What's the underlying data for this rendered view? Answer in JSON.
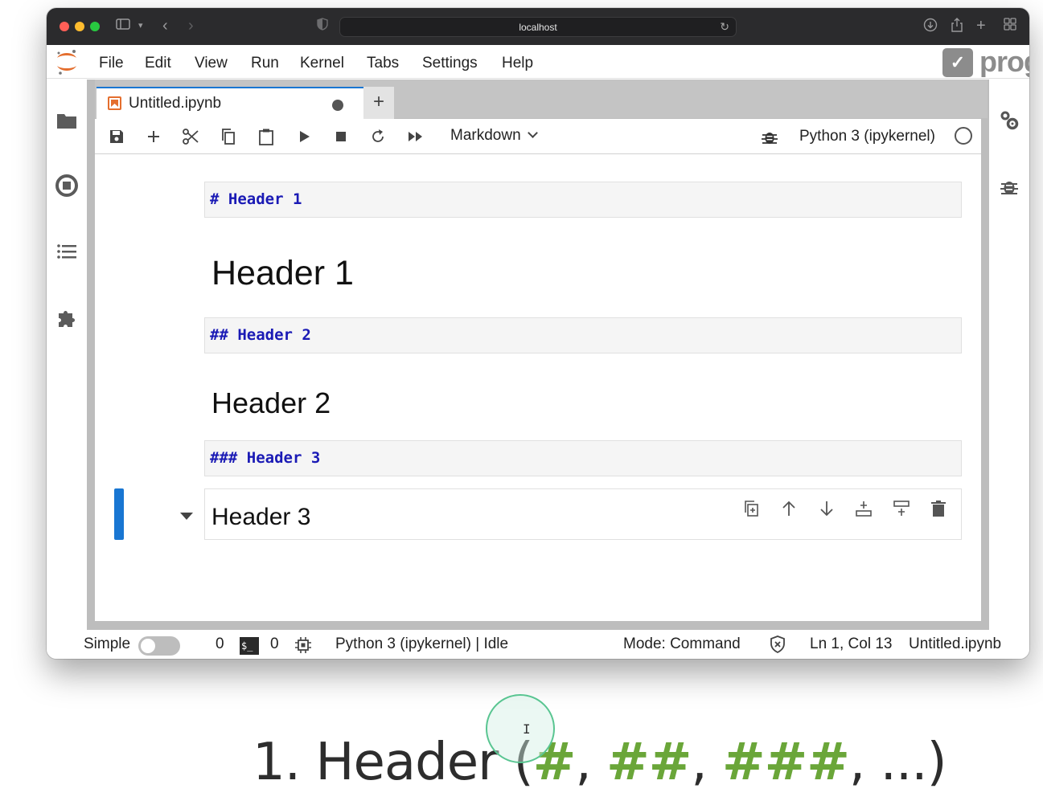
{
  "browser": {
    "url": "localhost"
  },
  "menubar": {
    "items": [
      "File",
      "Edit",
      "View",
      "Run",
      "Kernel",
      "Tabs",
      "Settings",
      "Help"
    ],
    "brand_text": "prog"
  },
  "notebook_tab": {
    "title": "Untitled.ipynb",
    "add_label": "+"
  },
  "toolbar": {
    "cell_type": "Markdown",
    "kernel_name": "Python 3 (ipykernel)"
  },
  "cells": {
    "raw1": "# Header 1",
    "rendered1": "Header 1",
    "raw2": "## Header 2",
    "rendered2": "Header 2",
    "raw3": "### Header 3",
    "rendered3": "Header 3"
  },
  "statusbar": {
    "simple_label": "Simple",
    "count1": "0",
    "terminal_icon_text": "$_",
    "count2": "0",
    "kernel_status": "Python 3 (ipykernel) | Idle",
    "mode": "Mode: Command",
    "cursor_pos": "Ln 1, Col 13",
    "filename": "Untitled.ipynb"
  },
  "caption": {
    "prefix": "1. Header (",
    "h1": "#",
    "sep1": ", ",
    "h2": "##",
    "sep2": ", ",
    "h3": "###",
    "suffix": ", ...)"
  },
  "colors": {
    "accent": "#1976d2",
    "markdown_raw": "#1a1ab5",
    "caption_hash": "#6aa639"
  }
}
